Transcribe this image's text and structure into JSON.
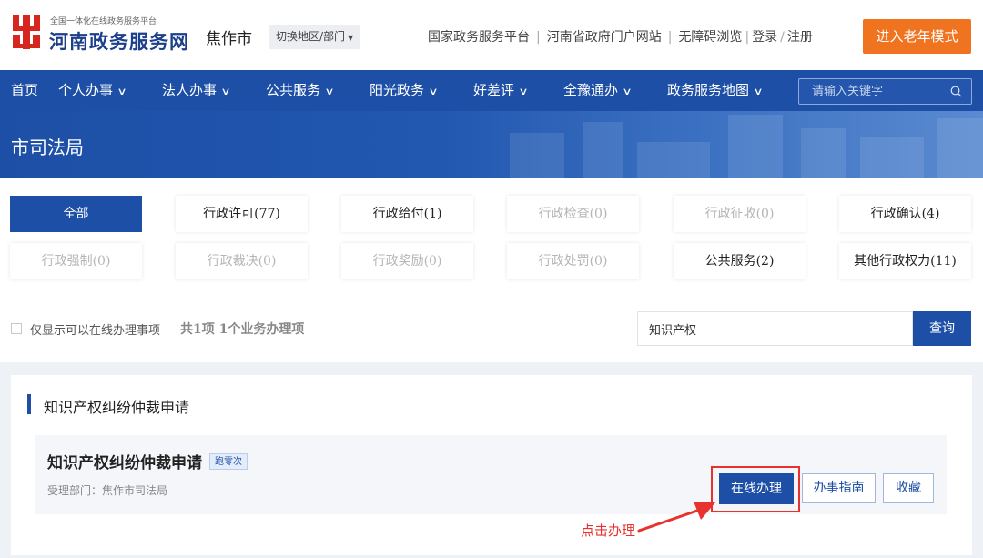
{
  "header": {
    "logo_icon": "henan-gov-logo",
    "logo_small": "全国一体化在线政务服务平台",
    "logo_big": "河南政务服务网",
    "city": "焦作市",
    "switch_label": "切换地区/部门",
    "links": [
      "国家政务服务平台",
      "河南省政府门户网站",
      "无障碍浏览",
      "登录",
      "注册"
    ],
    "elder_mode": "进入老年模式"
  },
  "nav": {
    "items": [
      "首页",
      "个人办事",
      "法人办事",
      "公共服务",
      "阳光政务",
      "好差评",
      "全豫通办",
      "政务服务地图"
    ],
    "search_placeholder": "请输入关键字"
  },
  "banner": {
    "title": "市司法局"
  },
  "filters": [
    {
      "label": "全部",
      "count": ""
    },
    {
      "label": "行政许可",
      "count": "(77)"
    },
    {
      "label": "行政给付",
      "count": "(1)"
    },
    {
      "label": "行政检查",
      "count": "(0)"
    },
    {
      "label": "行政征收",
      "count": "(0)"
    },
    {
      "label": "行政确认",
      "count": "(4)"
    },
    {
      "label": "行政强制",
      "count": "(0)"
    },
    {
      "label": "行政裁决",
      "count": "(0)"
    },
    {
      "label": "行政奖励",
      "count": "(0)"
    },
    {
      "label": "行政处罚",
      "count": "(0)"
    },
    {
      "label": "公共服务",
      "count": "(2)"
    },
    {
      "label": "其他行政权力",
      "count": "(11)"
    }
  ],
  "options": {
    "online_only_label": "仅显示可以在线办理事项",
    "count_text": "共1项 1个业务办理项"
  },
  "query": {
    "value": "知识产权",
    "button": "查询"
  },
  "results": {
    "section_title": "知识产权纠纷仲裁申请",
    "item": {
      "title": "知识产权纠纷仲裁申请",
      "badge": "跑零次",
      "department": "受理部门：焦作市司法局",
      "online_button": "在线办理",
      "guide_button": "办事指南",
      "favorite_button": "收藏"
    }
  },
  "annotation": {
    "text": "点击办理",
    "color": "#e8322d"
  },
  "colors": {
    "brand": "#1d4fa6",
    "accent": "#f0731f",
    "highlight": "#e8322d"
  }
}
